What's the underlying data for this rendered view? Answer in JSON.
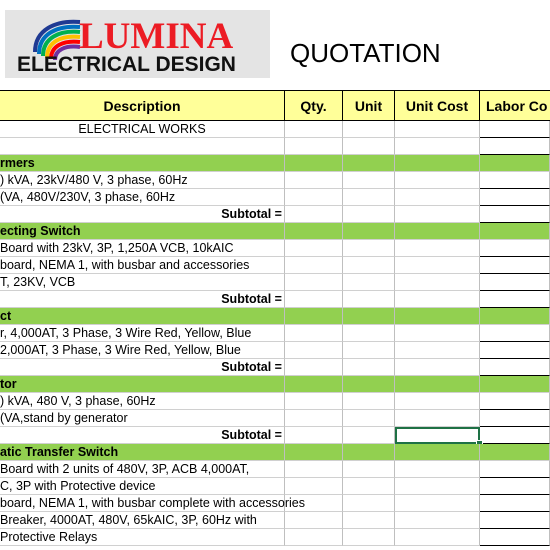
{
  "logo": {
    "brand": "LUMINA",
    "subtitle": "ELECTRICAL DESIGN",
    "colors": [
      "#1f3a93",
      "#0070c0",
      "#00b050",
      "#ffc000",
      "#ff0000",
      "#7030a0"
    ]
  },
  "document_title": "QUOTATION",
  "columns": {
    "description": "Description",
    "qty": "Qty.",
    "unit": "Unit",
    "unit_cost": "Unit Cost",
    "labor_cost": "Labor Co"
  },
  "rows": [
    {
      "type": "centered",
      "text": "ELECTRICAL WORKS"
    },
    {
      "type": "blank",
      "text": ""
    },
    {
      "type": "section",
      "text": "rmers"
    },
    {
      "type": "item",
      "text": ") kVA, 23kV/480 V, 3 phase, 60Hz"
    },
    {
      "type": "item",
      "text": "(VA, 480V/230V, 3 phase, 60Hz"
    },
    {
      "type": "subtotal",
      "text": "Subtotal ="
    },
    {
      "type": "section",
      "text": "ecting Switch"
    },
    {
      "type": "item",
      "text": " Board with 23kV, 3P, 1,250A VCB, 10kAIC"
    },
    {
      "type": "item",
      "text": "board, NEMA 1, with busbar and accessories"
    },
    {
      "type": "item",
      "text": "T, 23KV, VCB"
    },
    {
      "type": "subtotal",
      "text": "Subtotal ="
    },
    {
      "type": "section",
      "text": "ct"
    },
    {
      "type": "item",
      "text": "r, 4,000AT, 3 Phase, 3 Wire Red, Yellow, Blue"
    },
    {
      "type": "item",
      "text": " 2,000AT, 3 Phase, 3 Wire Red, Yellow, Blue"
    },
    {
      "type": "subtotal",
      "text": "Subtotal ="
    },
    {
      "type": "section",
      "text": "tor"
    },
    {
      "type": "item",
      "text": ") kVA, 480 V, 3 phase, 60Hz"
    },
    {
      "type": "item",
      "text": "(VA,stand by generator"
    },
    {
      "type": "subtotal",
      "text": "Subtotal ="
    },
    {
      "type": "section",
      "text": "atic Transfer Switch"
    },
    {
      "type": "item",
      "text": " Board with 2 units of 480V, 3P, ACB 4,000AT,"
    },
    {
      "type": "item",
      "text": "C, 3P with Protective device"
    },
    {
      "type": "item",
      "text": "board, NEMA 1, with busbar complete with accessories"
    },
    {
      "type": "item",
      "text": "Breaker, 4000AT, 480V, 65kAIC, 3P, 60Hz with"
    },
    {
      "type": "item",
      "text": "Protective Relays"
    }
  ]
}
